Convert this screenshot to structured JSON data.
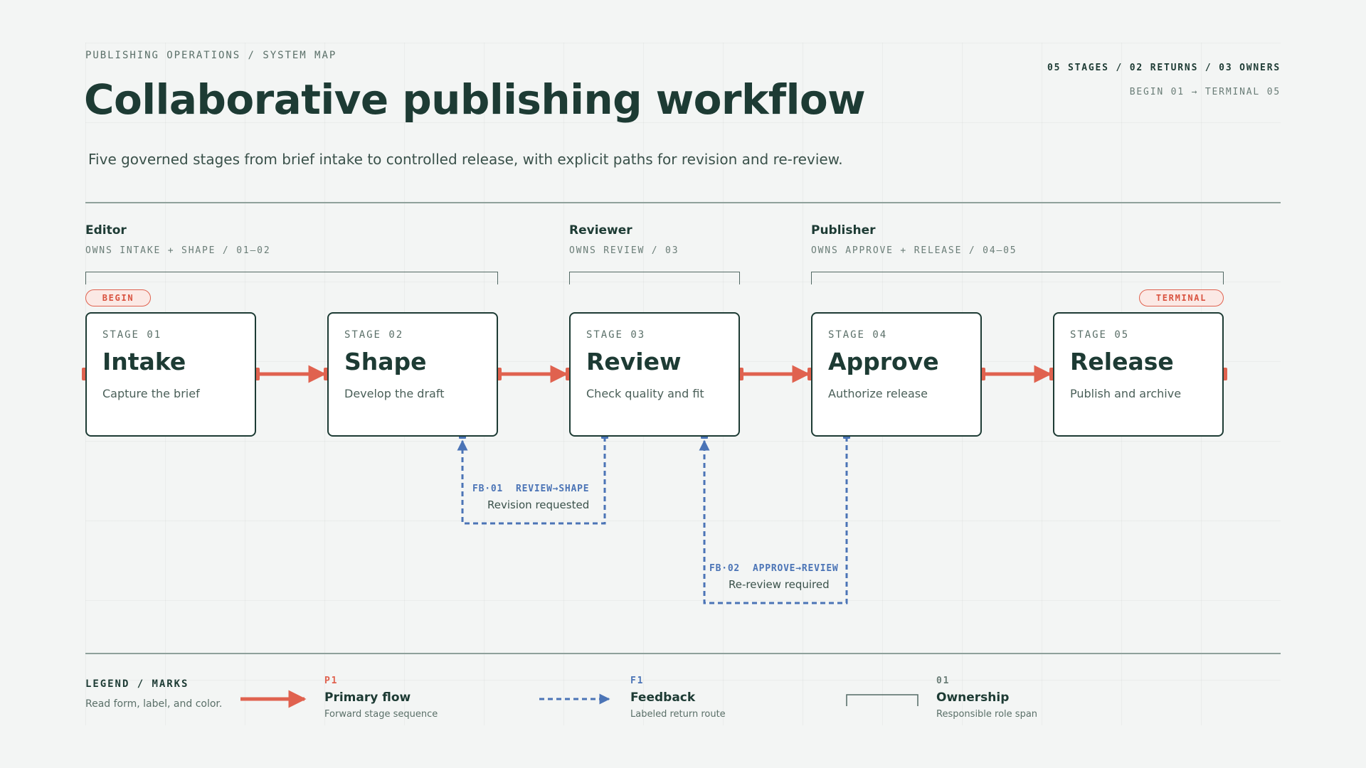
{
  "header": {
    "kicker": "PUBLISHING OPERATIONS / SYSTEM MAP",
    "title": "Collaborative publishing workflow",
    "subtitle": "Five governed stages from brief intake to controlled release, with explicit paths for revision and re-review.",
    "stats": "05 STAGES / 02 RETURNS / 03 OWNERS",
    "range": "BEGIN 01 → TERMINAL 05"
  },
  "owners": [
    {
      "name": "Editor",
      "sub": "OWNS INTAKE + SHAPE / 01–02"
    },
    {
      "name": "Reviewer",
      "sub": "OWNS REVIEW / 03"
    },
    {
      "name": "Publisher",
      "sub": "OWNS APPROVE + RELEASE / 04–05"
    }
  ],
  "markers": {
    "begin": "BEGIN",
    "terminal": "TERMINAL"
  },
  "stages": [
    {
      "num": "STAGE 01",
      "name": "Intake",
      "desc": "Capture the brief"
    },
    {
      "num": "STAGE 02",
      "name": "Shape",
      "desc": "Develop the draft"
    },
    {
      "num": "STAGE 03",
      "name": "Review",
      "desc": "Check quality and fit"
    },
    {
      "num": "STAGE 04",
      "name": "Approve",
      "desc": "Authorize release"
    },
    {
      "num": "STAGE 05",
      "name": "Release",
      "desc": "Publish and archive"
    }
  ],
  "feedback": [
    {
      "code": "FB·01",
      "route": "REVIEW→SHAPE",
      "desc": "Revision requested"
    },
    {
      "code": "FB·02",
      "route": "APPROVE→REVIEW",
      "desc": "Re-review required"
    }
  ],
  "legend": {
    "title": "LEGEND / MARKS",
    "sub": "Read form, label, and color.",
    "items": [
      {
        "code": "P1",
        "name": "Primary flow",
        "desc": "Forward stage sequence"
      },
      {
        "code": "F1",
        "name": "Feedback",
        "desc": "Labeled return route"
      },
      {
        "code": "01",
        "name": "Ownership",
        "desc": "Responsible role span"
      }
    ]
  },
  "colors": {
    "primary": "#e0624f",
    "feedback": "#4b74b6",
    "ink": "#1d3b34",
    "background": "#f3f5f4"
  }
}
